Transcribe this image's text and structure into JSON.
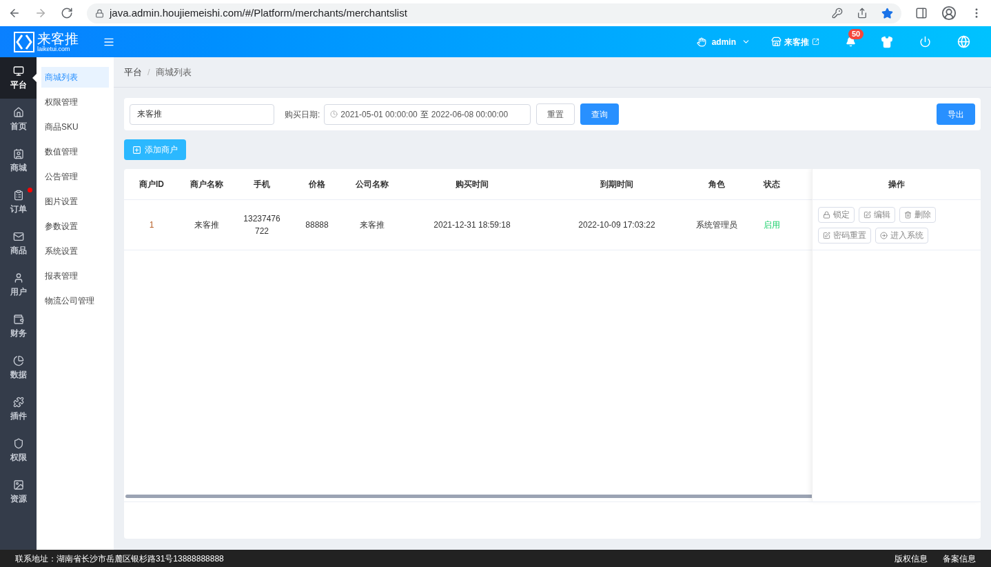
{
  "browser": {
    "url": "java.admin.houjiemeishi.com/#/Platform/merchants/merchantslist",
    "bookmarked": true
  },
  "header": {
    "logo_name": "来客推",
    "logo_domain": "laiketui.com",
    "user": "admin",
    "shop": "来客推",
    "notifications": "50"
  },
  "rail": [
    {
      "label": "平台",
      "selected": true,
      "dot": false
    },
    {
      "label": "首页",
      "selected": false,
      "dot": false
    },
    {
      "label": "商城",
      "selected": false,
      "dot": false
    },
    {
      "label": "订单",
      "selected": false,
      "dot": true
    },
    {
      "label": "商品",
      "selected": false,
      "dot": false
    },
    {
      "label": "用户",
      "selected": false,
      "dot": false
    },
    {
      "label": "财务",
      "selected": false,
      "dot": false
    },
    {
      "label": "数据",
      "selected": false,
      "dot": false
    },
    {
      "label": "插件",
      "selected": false,
      "dot": false
    },
    {
      "label": "权限",
      "selected": false,
      "dot": false
    },
    {
      "label": "资源",
      "selected": false,
      "dot": false
    }
  ],
  "submenu": [
    {
      "label": "商城列表",
      "selected": true
    },
    {
      "label": "权限管理",
      "selected": false
    },
    {
      "label": "商品SKU",
      "selected": false
    },
    {
      "label": "数值管理",
      "selected": false
    },
    {
      "label": "公告管理",
      "selected": false
    },
    {
      "label": "图片设置",
      "selected": false
    },
    {
      "label": "参数设置",
      "selected": false
    },
    {
      "label": "系统设置",
      "selected": false
    },
    {
      "label": "报表管理",
      "selected": false
    },
    {
      "label": "物流公司管理",
      "selected": false
    }
  ],
  "breadcrumb": [
    "平台",
    "商城列表"
  ],
  "breadcrumb_separator": "/",
  "filters": {
    "search_value": "来客推",
    "date_label": "购买日期:",
    "date_start": "2021-05-01 00:00:00",
    "date_separator": "至",
    "date_end": "2022-06-08 00:00:00",
    "reset": "重置",
    "query": "查询",
    "export": "导出"
  },
  "add_button": "添加商户",
  "table": {
    "columns": [
      "商户ID",
      "商户名称",
      "手机",
      "价格",
      "公司名称",
      "购买时间",
      "到期时间",
      "角色",
      "状态"
    ],
    "actions_column": "操作",
    "rows": [
      {
        "cells": [
          {
            "text": "1",
            "kind": "id"
          },
          {
            "text": "来客推",
            "kind": "text"
          },
          {
            "text": "13237476722",
            "kind": "text"
          },
          {
            "text": "88888",
            "kind": "text"
          },
          {
            "text": "来客推",
            "kind": "text"
          },
          {
            "text": "2021-12-31 18:59:18",
            "kind": "text"
          },
          {
            "text": "2022-10-09 17:03:22",
            "kind": "text"
          },
          {
            "text": "系统管理员",
            "kind": "text"
          },
          {
            "text": "启用",
            "kind": "status"
          }
        ],
        "actions": [
          {
            "label": "锁定",
            "kind": "lock"
          },
          {
            "label": "编辑",
            "kind": "edit"
          },
          {
            "label": "删除",
            "kind": "delete"
          },
          {
            "label": "密码重置",
            "kind": "edit"
          },
          {
            "label": "进入系统",
            "kind": "enter"
          }
        ]
      }
    ]
  },
  "footer": {
    "address": "联系地址：湖南省长沙市岳麓区银杉路31号13888888888",
    "links": [
      "版权信息",
      "备案信息"
    ]
  }
}
